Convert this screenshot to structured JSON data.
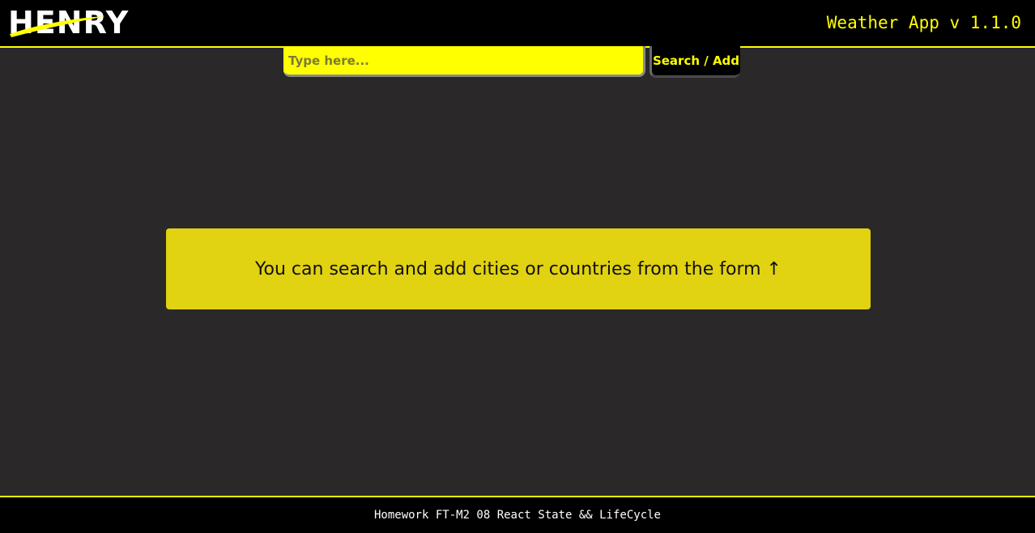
{
  "header": {
    "logo_text": "HENRY",
    "app_title": "Weather App v 1.1.0"
  },
  "search": {
    "placeholder": "Type here...",
    "value": "",
    "button_label": "Search / Add"
  },
  "main": {
    "notice_text": "You can search and add cities or countries from the form ↑"
  },
  "footer": {
    "text": "Homework FT-M2 08 React State && LifeCycle"
  },
  "colors": {
    "accent": "#ffff00",
    "background": "#2a2829",
    "notice_background": "#e1d212",
    "bar_background": "#000000"
  }
}
